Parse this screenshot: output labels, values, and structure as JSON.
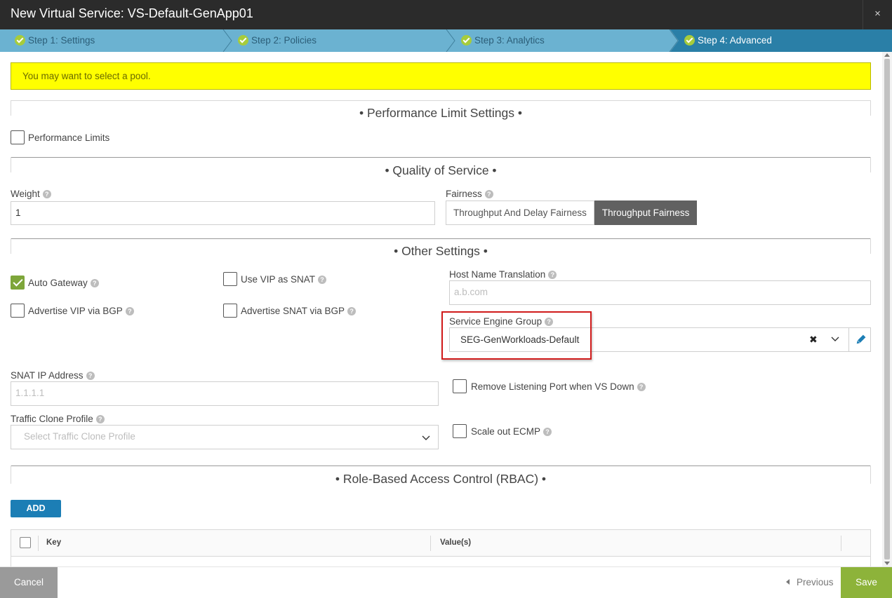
{
  "window": {
    "title": "New Virtual Service: VS-Default-GenApp01",
    "close_icon": "×"
  },
  "steps": [
    {
      "label": "Step 1: Settings",
      "status": "complete"
    },
    {
      "label": "Step 2: Policies",
      "status": "complete"
    },
    {
      "label": "Step 3: Analytics",
      "status": "complete"
    },
    {
      "label": "Step 4: Advanced",
      "status": "active"
    }
  ],
  "alert": {
    "text": "You may want to select a pool."
  },
  "performance": {
    "section_title": "• Performance Limit Settings •",
    "checkbox_label": "Performance Limits",
    "checked": false
  },
  "qos": {
    "section_title": "• Quality of Service •",
    "weight_label": "Weight",
    "weight_value": "1",
    "fairness_label": "Fairness",
    "fairness_options": [
      "Throughput And Delay Fairness",
      "Throughput Fairness"
    ],
    "fairness_selected": "Throughput Fairness"
  },
  "other": {
    "section_title": "• Other Settings •",
    "auto_gateway": {
      "label": "Auto Gateway",
      "checked": true
    },
    "use_vip_snat": {
      "label": "Use VIP as SNAT",
      "checked": false
    },
    "advertise_vip_bgp": {
      "label": "Advertise VIP via BGP",
      "checked": false
    },
    "advertise_snat_bgp": {
      "label": "Advertise SNAT via BGP",
      "checked": false
    },
    "host_name_translation": {
      "label": "Host Name Translation",
      "placeholder": "a.b.com"
    },
    "service_engine_group": {
      "label": "Service Engine Group",
      "value": "SEG-GenWorkloads-Default",
      "clear": "✖"
    },
    "snat_ip": {
      "label": "SNAT IP Address",
      "placeholder": "1.1.1.1"
    },
    "remove_listening_port": {
      "label": "Remove Listening Port when VS Down",
      "checked": false
    },
    "traffic_clone_profile": {
      "label": "Traffic Clone Profile",
      "placeholder": "Select Traffic Clone Profile"
    },
    "scale_out_ecmp": {
      "label": "Scale out ECMP",
      "checked": false
    }
  },
  "rbac": {
    "section_title": "• Role-Based Access Control (RBAC) •",
    "add_label": "ADD",
    "columns": [
      "Key",
      "Value(s)"
    ]
  },
  "footer": {
    "cancel_label": "Cancel",
    "previous_label": "Previous",
    "save_label": "Save"
  },
  "help_icon": "?",
  "colors": {
    "title_bar": "#2b2b2b",
    "step_bar": "#6bb2d1",
    "step_active": "#2a7fa7",
    "alert": "#ffff00",
    "checkbox_checked": "#7ea63a",
    "add_button": "#1c7eb5",
    "save_button": "#8db33a",
    "highlight_box": "#d11b1b"
  }
}
